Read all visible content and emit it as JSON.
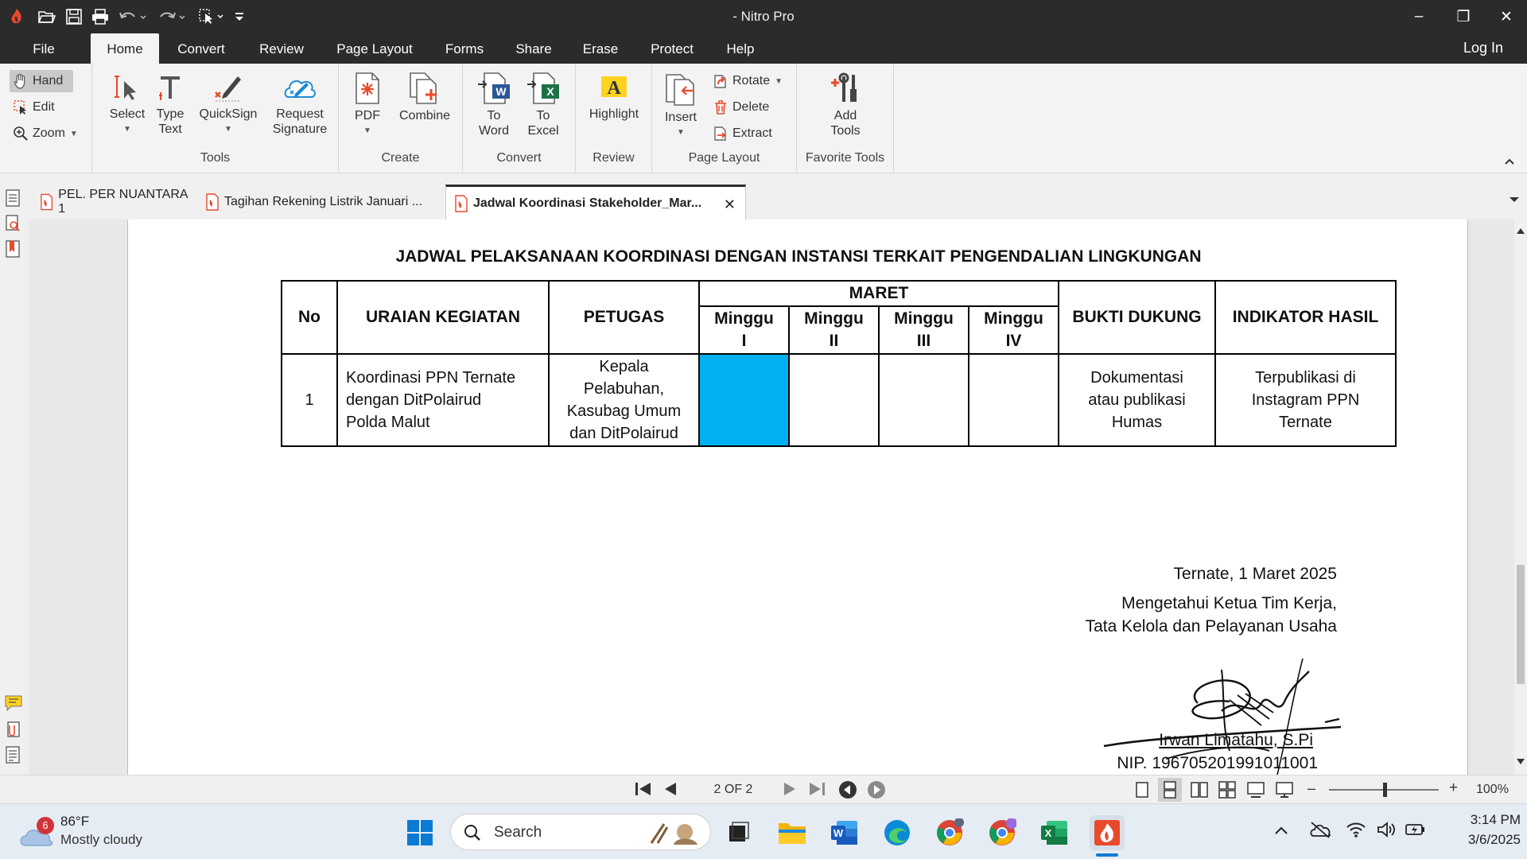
{
  "window": {
    "title": "- Nitro Pro",
    "controls": {
      "minimize": "–",
      "restore": "❐",
      "close": "✕"
    }
  },
  "quick_access": [
    "open-icon",
    "save-icon",
    "print-icon",
    "undo-icon",
    "redo-icon",
    "select-tool-icon",
    "customize-icon"
  ],
  "menu": {
    "items": [
      "File",
      "Home",
      "Convert",
      "Review",
      "Page Layout",
      "Forms",
      "Share",
      "Erase",
      "Protect",
      "Help"
    ],
    "active": "Home",
    "login": "Log In"
  },
  "ribbon": {
    "nav_tools": {
      "hand": "Hand",
      "edit": "Edit",
      "zoom": "Zoom"
    },
    "tools": {
      "label": "Tools",
      "select": "Select",
      "type_text_1": "Type",
      "type_text_2": "Text",
      "quicksign": "QuickSign",
      "request_1": "Request",
      "request_2": "Signature"
    },
    "create": {
      "label": "Create",
      "pdf": "PDF",
      "combine": "Combine"
    },
    "convert": {
      "label": "Convert",
      "to_word_1": "To",
      "to_word_2": "Word",
      "to_excel_1": "To",
      "to_excel_2": "Excel"
    },
    "review": {
      "label": "Review",
      "highlight": "Highlight"
    },
    "page_layout": {
      "label": "Page Layout",
      "insert": "Insert",
      "rotate": "Rotate",
      "delete": "Delete",
      "extract": "Extract"
    },
    "favorite": {
      "label": "Favorite Tools",
      "add_1": "Add",
      "add_2": "Tools"
    }
  },
  "doc_tabs": [
    {
      "label": "PEL. PER NUANTARA 1",
      "active": false
    },
    {
      "label": "Tagihan Rekening Listrik Januari ...",
      "active": false
    },
    {
      "label": "Jadwal Koordinasi Stakeholder_Mar...",
      "active": true
    }
  ],
  "document": {
    "title": "JADWAL PELAKSANAAN KOORDINASI DENGAN INSTANSI TERKAIT PENGENDALIAN LINGKUNGAN",
    "table": {
      "headers": {
        "no": "No",
        "uraian": "URAIAN KEGIATAN",
        "petugas": "PETUGAS",
        "month": "MARET",
        "bukti": "BUKTI DUKUNG",
        "indikator": "INDIKATOR HASIL"
      },
      "weeks": [
        {
          "l1": "Minggu",
          "l2": "I"
        },
        {
          "l1": "Minggu",
          "l2": "II"
        },
        {
          "l1": "Minggu",
          "l2": "III"
        },
        {
          "l1": "Minggu",
          "l2": "IV"
        }
      ],
      "row": {
        "no": "1",
        "uraian": [
          "Koordinasi PPN Ternate",
          "dengan DitPolairud",
          "Polda Malut"
        ],
        "petugas": [
          "Kepala",
          "Pelabuhan,",
          "Kasubag Umum",
          "dan DitPolairud"
        ],
        "bukti": [
          "Dokumentasi",
          "atau publikasi",
          "Humas"
        ],
        "indikator": [
          "Terpublikasi di",
          "Instagram PPN",
          "Ternate"
        ],
        "highlight_week": 1
      },
      "highlight_color": "#00b0f0"
    },
    "signature": {
      "place_date": "Ternate, 1 Maret 2025",
      "line1": "Mengetahui Ketua Tim Kerja,",
      "line2": "Tata Kelola dan Pelayanan Usaha",
      "name": "Irwan Limatahu, S.Pi",
      "nip": "NIP. 196705201991011001"
    }
  },
  "status": {
    "page": "2 OF 2",
    "zoom": "100%",
    "zoom_minus": "–",
    "zoom_plus": "+"
  },
  "taskbar": {
    "weather_badge": "6",
    "temperature": "86°F",
    "condition": "Mostly cloudy",
    "search_placeholder": "Search",
    "time": "3:14 PM",
    "date": "3/6/2025"
  },
  "colors": {
    "accent": "#e8492b",
    "titlebar": "#2b2b2b",
    "ribbon": "#f3f3f3",
    "highlight": "#00b0f0"
  }
}
